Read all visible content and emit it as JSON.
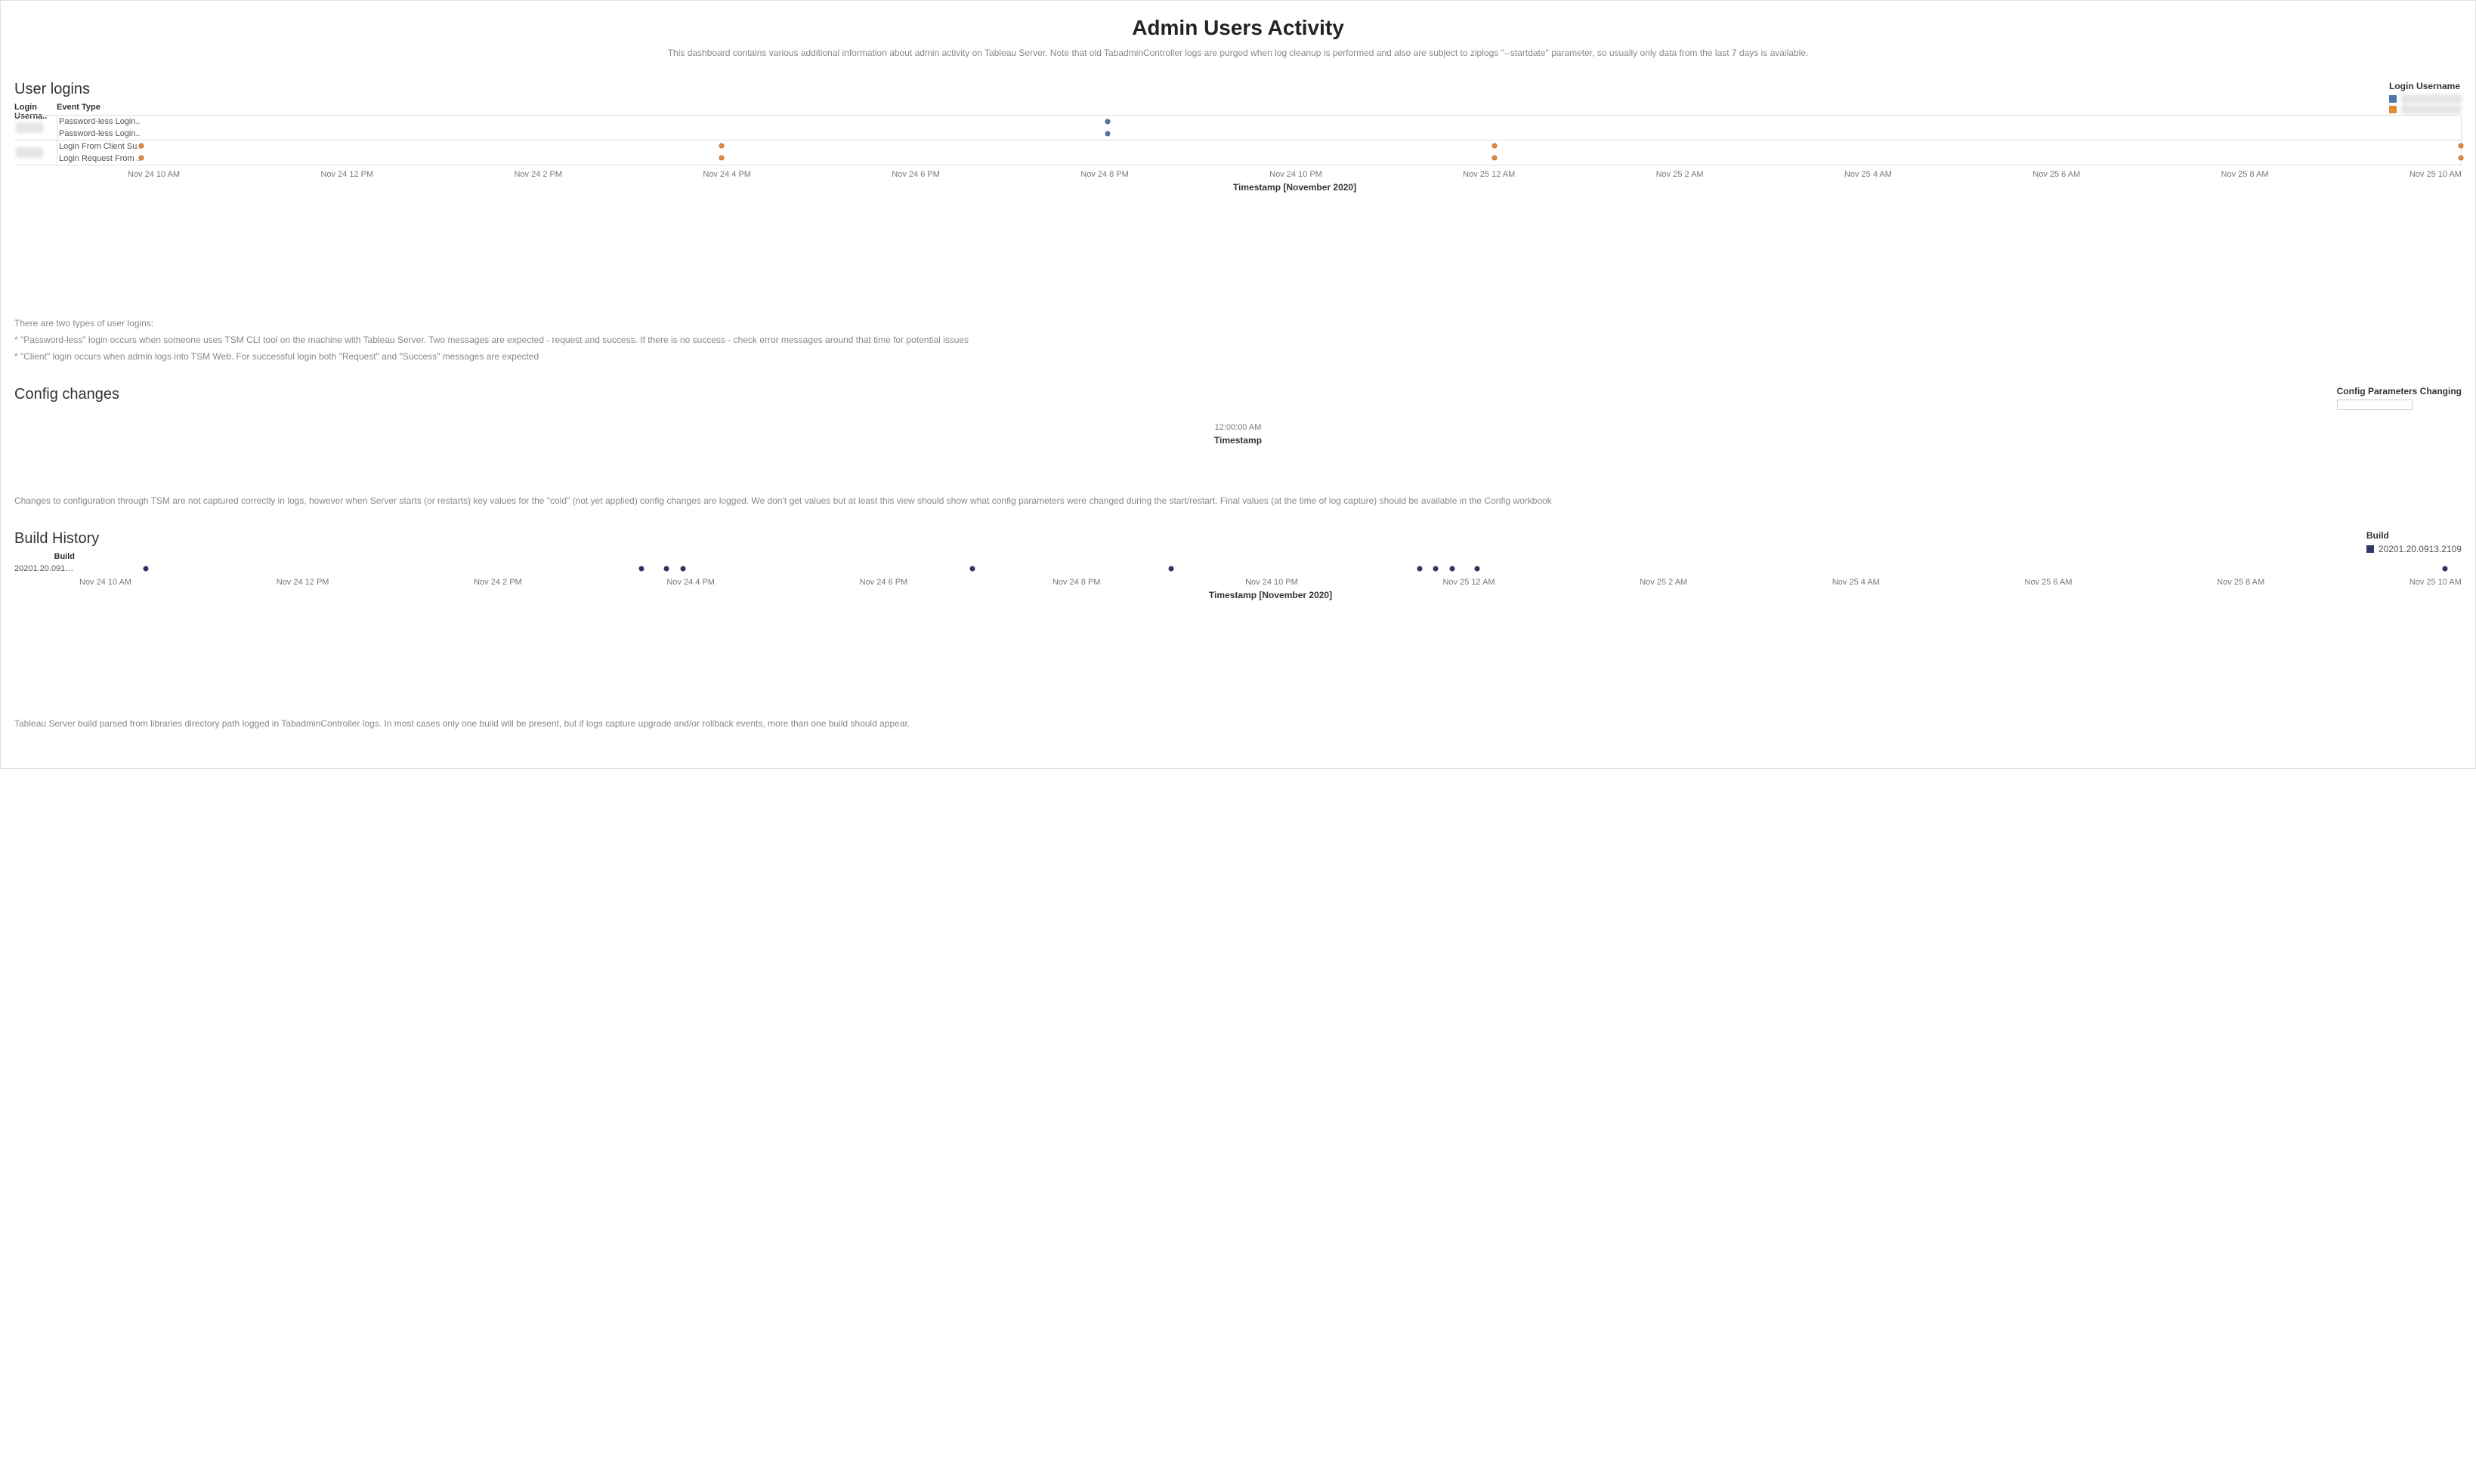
{
  "page": {
    "title": "Admin Users Activity",
    "subtitle": "This dashboard contains various additional information about admin activity on Tableau Server. Note that old TabadminController logs are purged when log cleanup is performed and also are subject to ziplogs \"--startdate\" parameter, so usually only data from the last 7 days is available."
  },
  "user_logins": {
    "title": "User logins",
    "col_user": "Login Userna..",
    "col_event": "Event Type",
    "axis_label": "Timestamp [November 2020]",
    "ticks": [
      "Nov 24 10 AM",
      "Nov 24 12 PM",
      "Nov 24 2 PM",
      "Nov 24 4 PM",
      "Nov 24 6 PM",
      "Nov 24 8 PM",
      "Nov 24 10 PM",
      "Nov 25 12 AM",
      "Nov 25 2 AM",
      "Nov 25 4 AM",
      "Nov 25 6 AM",
      "Nov 25 8 AM",
      "Nov 25 10 AM"
    ],
    "rows": {
      "group1": [
        "Password-less Login..",
        "Password-less Login.."
      ],
      "group2": [
        "Login From Client Su..",
        "Login Request From .."
      ]
    },
    "legend_title": "Login Username",
    "note1": "There are two types of user logins:",
    "note2": "* \"Password-less\" login occurs when someone uses TSM CLI tool on the machine with Tableau Server. Two messages are expected - request and success. If there is no success - check error messages around that time for potential issues",
    "note3": "* \"Client\" login occurs when admin logs into TSM Web. For successful login both \"Request\" and \"Success\" messages are expected"
  },
  "config_changes": {
    "title": "Config changes",
    "tick": "12:00:00 AM",
    "axis_label": "Timestamp",
    "legend_title": "Config Parameters Changing",
    "note": "Changes to configuration through TSM are not captured correctly in logs, however when Server starts (or restarts) key values for the \"cold\" (not yet applied) config changes are logged. We don't get values but at least this view should show what config parameters were changed during the start/restart. Final values (at the time of log capture) should be available in the Config workbook"
  },
  "build_history": {
    "title": "Build History",
    "col_build": "Build",
    "build_value": "20201.20.0913...",
    "axis_label": "Timestamp [November 2020]",
    "ticks": [
      "Nov 24 10 AM",
      "Nov 24 12 PM",
      "Nov 24 2 PM",
      "Nov 24 4 PM",
      "Nov 24 6 PM",
      "Nov 24 8 PM",
      "Nov 24 10 PM",
      "Nov 25 12 AM",
      "Nov 25 2 AM",
      "Nov 25 4 AM",
      "Nov 25 6 AM",
      "Nov 25 8 AM",
      "Nov 25 10 AM"
    ],
    "legend_title": "Build",
    "legend_item": "20201.20.0913.2109",
    "note": "Tableau Server build parsed from libraries directory path logged in TabadminController logs. In most cases only one build will be present, but if logs capture upgrade and/or rollback events, more than one build should appear."
  },
  "chart_data": [
    {
      "type": "scatter",
      "name": "User logins",
      "xlabel": "Timestamp [November 2020]",
      "x_ticks": [
        "Nov 24 10 AM",
        "Nov 24 12 PM",
        "Nov 24 2 PM",
        "Nov 24 4 PM",
        "Nov 24 6 PM",
        "Nov 24 8 PM",
        "Nov 24 10 PM",
        "Nov 25 12 AM",
        "Nov 25 2 AM",
        "Nov 25 4 AM",
        "Nov 25 6 AM",
        "Nov 25 8 AM",
        "Nov 25 10 AM"
      ],
      "categories": [
        "Password-less Login Request",
        "Password-less Login Success",
        "Login From Client Success",
        "Login Request From Client"
      ],
      "series": [
        {
          "name": "User A",
          "color": "#4e79a7",
          "points": [
            {
              "y": "Password-less Login Request",
              "x": "Nov 24 8 PM"
            },
            {
              "y": "Password-less Login Success",
              "x": "Nov 24 8 PM"
            }
          ]
        },
        {
          "name": "User B",
          "color": "#e5893c",
          "points": [
            {
              "y": "Login From Client Success",
              "x": "Nov 24 10 AM"
            },
            {
              "y": "Login From Client Success",
              "x": "Nov 24 4 PM"
            },
            {
              "y": "Login From Client Success",
              "x": "Nov 25 12 AM"
            },
            {
              "y": "Login From Client Success",
              "x": "Nov 25 10 AM"
            },
            {
              "y": "Login Request From Client",
              "x": "Nov 24 10 AM"
            },
            {
              "y": "Login Request From Client",
              "x": "Nov 24 4 PM"
            },
            {
              "y": "Login Request From Client",
              "x": "Nov 25 12 AM"
            },
            {
              "y": "Login Request From Client",
              "x": "Nov 25 10 AM"
            }
          ]
        }
      ]
    },
    {
      "type": "scatter",
      "name": "Config changes",
      "xlabel": "Timestamp",
      "x_ticks": [
        "12:00:00 AM"
      ],
      "series": []
    },
    {
      "type": "scatter",
      "name": "Build History",
      "xlabel": "Timestamp [November 2020]",
      "x_ticks": [
        "Nov 24 10 AM",
        "Nov 24 12 PM",
        "Nov 24 2 PM",
        "Nov 24 4 PM",
        "Nov 24 6 PM",
        "Nov 24 8 PM",
        "Nov 24 10 PM",
        "Nov 25 12 AM",
        "Nov 25 2 AM",
        "Nov 25 4 AM",
        "Nov 25 6 AM",
        "Nov 25 8 AM",
        "Nov 25 10 AM"
      ],
      "series": [
        {
          "name": "20201.20.0913.2109",
          "color": "#2b3a67",
          "x": [
            "Nov 24 10:40 AM",
            "Nov 24 3:40 PM",
            "Nov 24 3:55 PM",
            "Nov 24 4:05 PM",
            "Nov 24 7:00 PM",
            "Nov 24 9:00 PM",
            "Nov 24 11:30 PM",
            "Nov 24 11:40 PM",
            "Nov 24 11:50 PM",
            "Nov 25 12:05 AM",
            "Nov 25 9:50 AM"
          ]
        }
      ]
    }
  ]
}
